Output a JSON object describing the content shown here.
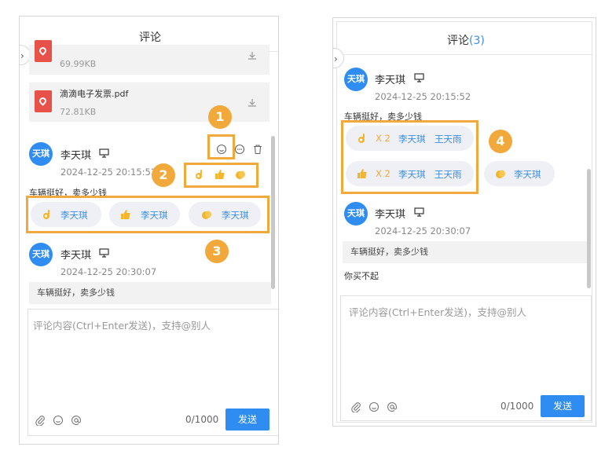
{
  "left_panel": {
    "title": "评论",
    "files": [
      {
        "name": "",
        "size": "69.99KB"
      },
      {
        "name": "滴滴电子发票.pdf",
        "size": "72.81KB"
      }
    ],
    "comments": [
      {
        "avatar": "天琪",
        "user": "李天琪",
        "time": "2024-12-25 20:15:52",
        "text": "车辆挺好，卖多少钱",
        "reactions": [
          {
            "emoji": "ok-hand-icon",
            "user": "李天琪"
          },
          {
            "emoji": "thumbs-up-icon",
            "user": "李天琪"
          },
          {
            "emoji": "clap-icon",
            "user": "李天琪"
          }
        ]
      },
      {
        "avatar": "天琪",
        "user": "李天琪",
        "time": "2024-12-25 20:30:07",
        "text": "车辆挺好，卖多少钱"
      }
    ],
    "editor": {
      "placeholder": "评论内容(Ctrl+Enter发送)，支持@别人",
      "counter": "0/1000",
      "send": "发送"
    },
    "badges": [
      "1",
      "2",
      "3"
    ]
  },
  "right_panel": {
    "title": "评论",
    "count": "(3)",
    "comments": [
      {
        "avatar": "天琪",
        "user": "李天琪",
        "time": "2024-12-25 20:15:52",
        "text": "车辆挺好，卖多少钱",
        "reactions": [
          {
            "emoji": "ok-hand-icon",
            "count": "X 2",
            "users": [
              "李天琪",
              "王天雨"
            ]
          },
          {
            "emoji": "thumbs-up-icon",
            "count": "X 2",
            "users": [
              "李天琪",
              "王天雨"
            ]
          },
          {
            "emoji": "clap-icon",
            "users": [
              "李天琪"
            ]
          }
        ]
      },
      {
        "avatar": "天琪",
        "user": "李天琪",
        "time": "2024-12-25 20:30:07",
        "quote": "车辆挺好，卖多少钱",
        "text": "你买不起"
      }
    ],
    "editor": {
      "placeholder": "评论内容(Ctrl+Enter发送)，支持@别人",
      "counter": "0/1000",
      "send": "发送"
    },
    "badge": "4"
  },
  "colors": {
    "accent": "#2f8cf0",
    "highlight": "#f2a93b",
    "pdf": "#e8504a",
    "link": "#3a8ee6"
  }
}
